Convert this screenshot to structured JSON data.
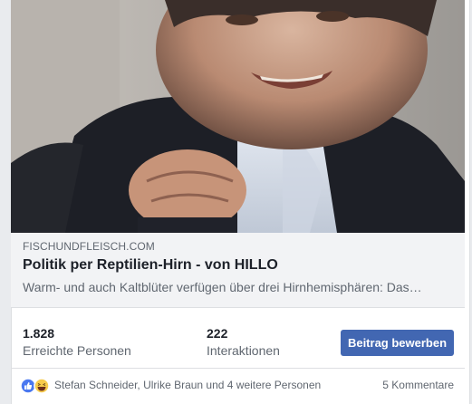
{
  "post": {
    "link_preview": {
      "domain": "FISCHUNDFLEISCH.COM",
      "title": "Politik per Reptilien-Hirn - von HILLO",
      "description": "Warm- und auch Kaltblüter verfügen über drei Hirnhemisphären: Das…"
    },
    "stats": {
      "reach_value": "1.828",
      "reach_label": "Erreichte Personen",
      "interactions_value": "222",
      "interactions_label": "Interaktionen"
    },
    "boost_button_label": "Beitrag bewerben",
    "reactions": {
      "icons": [
        "like-icon",
        "haha-icon"
      ],
      "summary": "Stefan Schneider, Ulrike Braun und 4 weitere Personen"
    },
    "comments_count_label": "5 Kommentare"
  },
  "colors": {
    "brand_blue": "#4267b2",
    "text_primary": "#1d2129",
    "text_secondary": "#606770",
    "preview_bg": "#f2f3f5"
  }
}
